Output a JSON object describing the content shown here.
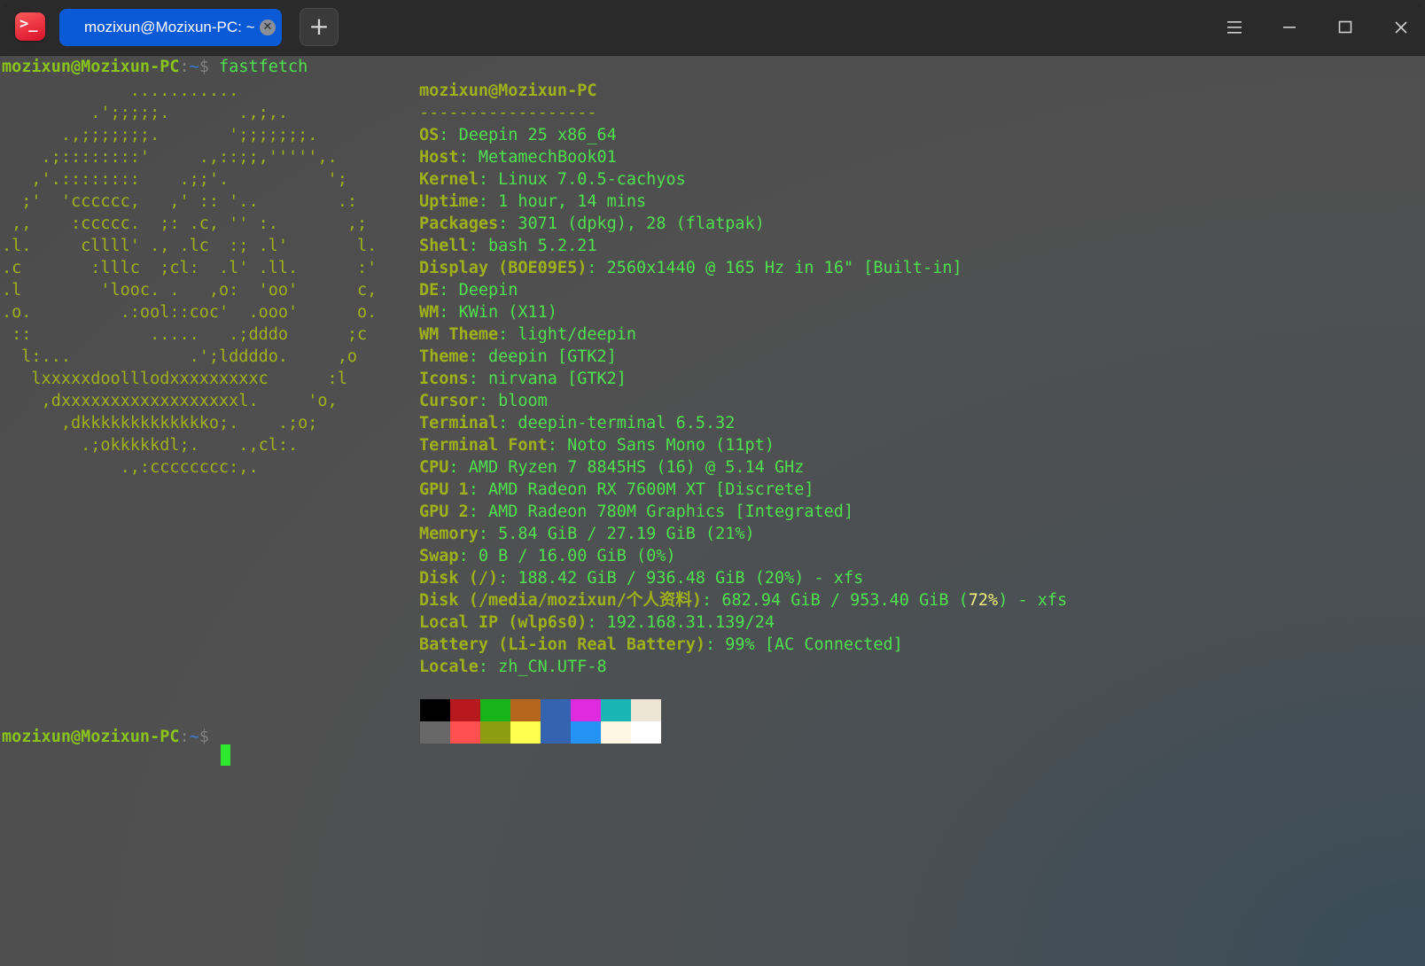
{
  "window": {
    "tab_title": "mozixun@Mozixun-PC: ~",
    "new_tab_symbol": "+"
  },
  "prompt": {
    "user_host": "mozixun@Mozixun-PC",
    "colon": ":",
    "path": "~",
    "dollar": "$",
    "command": " fastfetch"
  },
  "logo_lines": [
    "             ...........",
    "         .';;;;;.       .,;,.",
    "      .,;;;;;;;.       ';;;;;;;.",
    "    .;::::::::'     .,::;;,''''',.",
    "   ,'.::::::::    .;;'.          ';",
    "  ;'  'cccccc,   ,' :: '..        .:",
    " ,,    :ccccc.  ;: .c, '' :.       ,;",
    ".l.     cllll' ., .lc  :; .l'       l.",
    ".c       :lllc  ;cl:  .l' .ll.      :'",
    ".l        'looc. .   ,o:  'oo'      c,",
    ".o.         .:ool::coc'  .ooo'      o.",
    " ::            .....   .;dddo      ;c",
    "  l:...            .';lddddo.     ,o",
    "   lxxxxxdoolllodxxxxxxxxxc      :l",
    "    ,dxxxxxxxxxxxxxxxxxxl.     'o,",
    "      ,dkkkkkkkkkkkkko;.    .;o;",
    "        .;okkkkkdl;.    .,cl:.",
    "            .,:cccccccc:,."
  ],
  "info": {
    "title": "mozixun@Mozixun-PC",
    "dashes": "------------------",
    "rows": [
      {
        "key": "OS",
        "value": "Deepin 25 x86_64"
      },
      {
        "key": "Host",
        "value": "MetamechBook01"
      },
      {
        "key": "Kernel",
        "value": "Linux 7.0.5-cachyos"
      },
      {
        "key": "Uptime",
        "value": "1 hour, 14 mins"
      },
      {
        "key": "Packages",
        "value": "3071 (dpkg), 28 (flatpak)"
      },
      {
        "key": "Shell",
        "value": "bash 5.2.21"
      },
      {
        "key": "Display (BOE09E5)",
        "value": "2560x1440 @ 165 Hz in 16\" [Built-in]"
      },
      {
        "key": "DE",
        "value": "Deepin"
      },
      {
        "key": "WM",
        "value": "KWin (X11)"
      },
      {
        "key": "WM Theme",
        "value": "light/deepin"
      },
      {
        "key": "Theme",
        "value": "deepin [GTK2]"
      },
      {
        "key": "Icons",
        "value": "nirvana [GTK2]"
      },
      {
        "key": "Cursor",
        "value": "bloom"
      },
      {
        "key": "Terminal",
        "value": "deepin-terminal 6.5.32"
      },
      {
        "key": "Terminal Font",
        "value": "Noto Sans Mono (11pt)"
      },
      {
        "key": "CPU",
        "value": "AMD Ryzen 7 8845HS (16) @ 5.14 GHz"
      },
      {
        "key": "GPU 1",
        "value": "AMD Radeon RX 7600M XT [Discrete]"
      },
      {
        "key": "GPU 2",
        "value": "AMD Radeon 780M Graphics [Integrated]"
      },
      {
        "key": "Memory",
        "value": "5.84 GiB / 27.19 GiB (21%)"
      },
      {
        "key": "Swap",
        "value": "0 B / 16.00 GiB (0%)"
      },
      {
        "key": "Disk (/)",
        "value": "188.42 GiB / 936.48 GiB (20%) - xfs"
      }
    ],
    "disk2": {
      "key": "Disk (/media/mozixun/个人资料)",
      "pre": "682.94 GiB / 953.40 GiB (",
      "highlight": "72%",
      "post": ") - xfs"
    },
    "rows2": [
      {
        "key": "Local IP (wlp6s0)",
        "value": "192.168.31.139/24"
      },
      {
        "key": "Battery (Li-ion Real Battery)",
        "value": "99% [AC Connected]"
      },
      {
        "key": "Locale",
        "value": "zh_CN.UTF-8"
      }
    ]
  },
  "palette": {
    "top": [
      "#000000",
      "#b8191d",
      "#19b419",
      "#b5661d",
      "#3463b0",
      "#e02ae0",
      "#19b5b5",
      "#ede5d5"
    ],
    "bottom": [
      "#686868",
      "#ff5050",
      "#8c9d14",
      "#ffff4f",
      "#3463b0",
      "#2592f5",
      "#fdf6e3",
      "#ffffff"
    ]
  }
}
